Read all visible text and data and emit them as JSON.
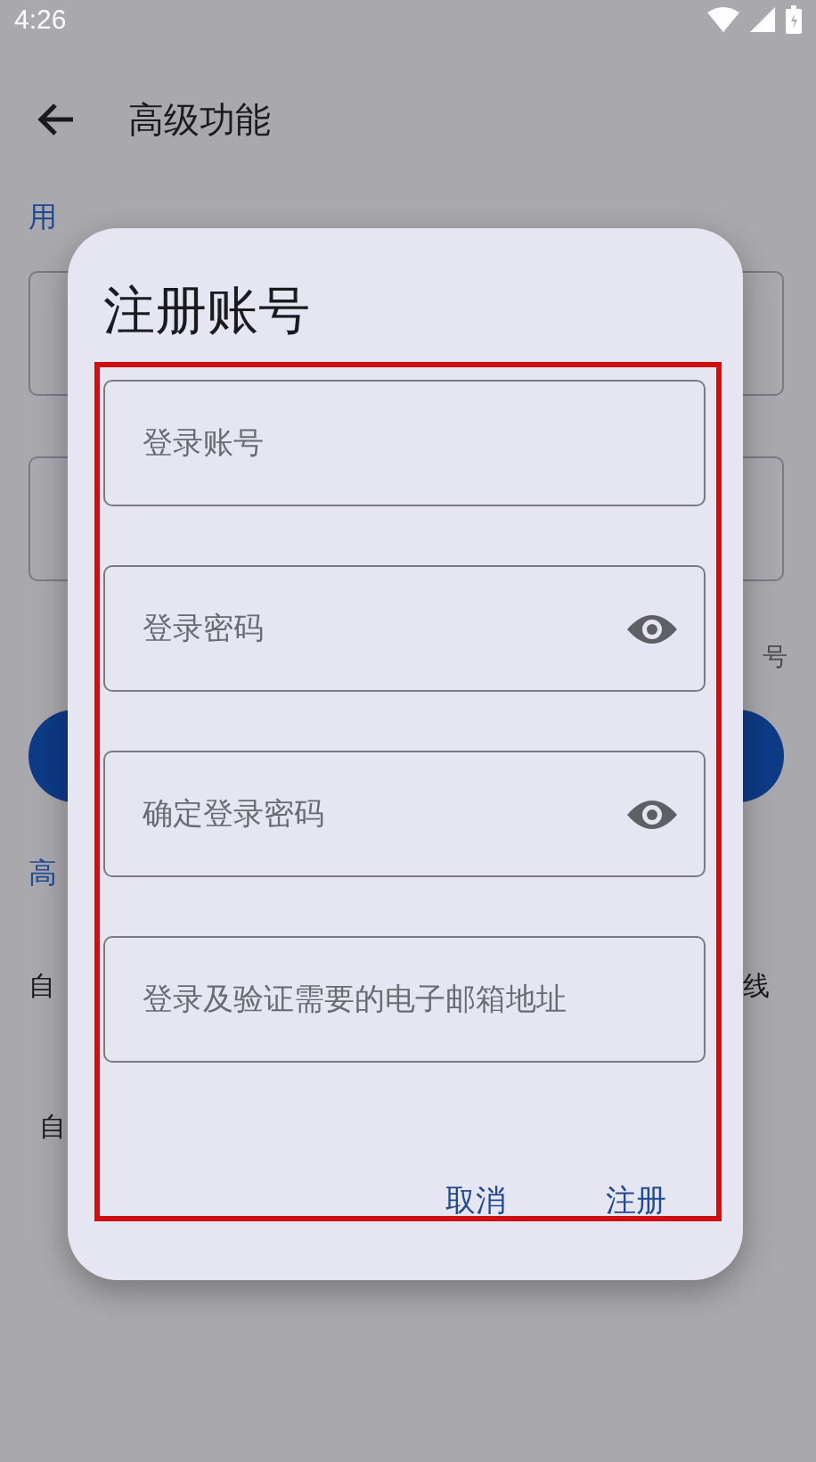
{
  "status_bar": {
    "time": "4:26"
  },
  "app_bar": {
    "title": "高级功能"
  },
  "background": {
    "section_1": "用",
    "fields": [
      {
        "kind": "outlined"
      },
      {
        "kind": "outlined"
      }
    ],
    "note": "号",
    "section_2": "高",
    "row_1_left": "自",
    "row_1_right": "线",
    "row_2_left": "自"
  },
  "dialog": {
    "title": "注册账号",
    "fields": [
      {
        "kind": "text",
        "placeholder": "登录账号"
      },
      {
        "kind": "password",
        "placeholder": "登录密码"
      },
      {
        "kind": "password",
        "placeholder": "确定登录密码"
      },
      {
        "kind": "text",
        "placeholder": "登录及验证需要的电子邮箱地址"
      }
    ],
    "buttons": [
      "取消",
      "注册"
    ]
  }
}
